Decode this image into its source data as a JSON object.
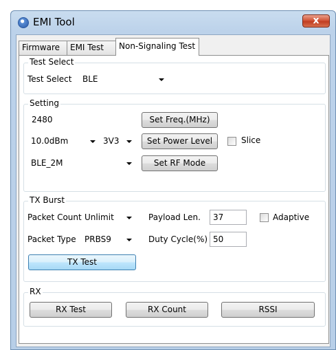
{
  "window": {
    "title": "EMI Tool",
    "close_glyph": "x"
  },
  "tabs": [
    {
      "label": "Firmware",
      "active": false
    },
    {
      "label": "EMI Test",
      "active": false
    },
    {
      "label": "Non-Signaling Test",
      "active": true
    }
  ],
  "test_select": {
    "group_title": "Test Select",
    "label": "Test Select",
    "value": "BLE"
  },
  "setting": {
    "group_title": "Setting",
    "freq_value": "2480",
    "set_freq_label": "Set Freq.(MHz)",
    "power_value": "10.0dBm",
    "voltage_value": "3V3",
    "set_power_label": "Set Power Level",
    "slice_label": "Slice",
    "slice_checked": false,
    "rf_mode_value": "BLE_2M",
    "set_rf_mode_label": "Set RF Mode"
  },
  "tx_burst": {
    "group_title": "TX Burst",
    "packet_count_label": "Packet Count",
    "packet_count_value": "Unlimit",
    "payload_len_label": "Payload Len.",
    "payload_len_value": "37",
    "adaptive_label": "Adaptive",
    "adaptive_checked": false,
    "packet_type_label": "Packet Type",
    "packet_type_value": "PRBS9",
    "duty_cycle_label": "Duty Cycle(%)",
    "duty_cycle_value": "50",
    "tx_test_label": "TX Test"
  },
  "rx": {
    "group_title": "RX",
    "rx_test_label": "RX Test",
    "rx_count_label": "RX Count",
    "rssi_label": "RSSI"
  }
}
